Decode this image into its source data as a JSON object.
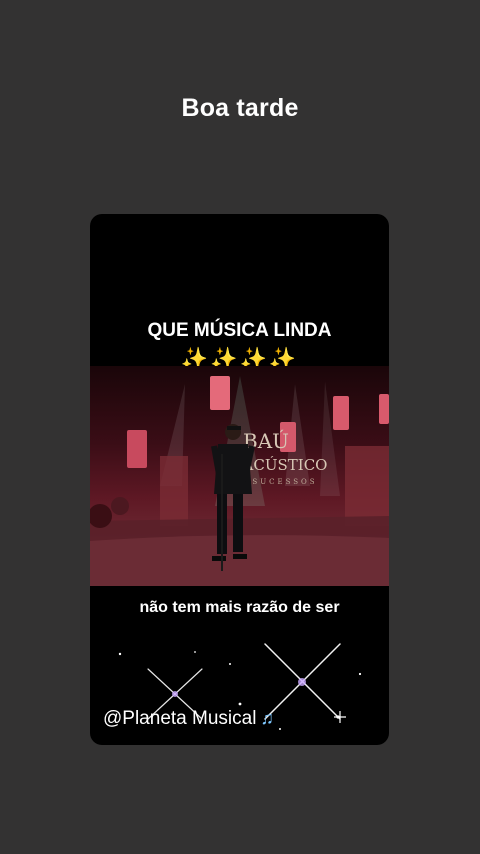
{
  "header": {
    "title": "Boa tarde"
  },
  "story": {
    "overlay_title": "QUE MÚSICA LINDA",
    "sparkles": "✨✨✨✨",
    "video": {
      "stage_sign_line1": "BAÚ",
      "stage_sign_line2": "ACÚSTICO",
      "stage_sign_line3": "SUCESSOS"
    },
    "caption": "não tem mais razão de ser",
    "handle": "@Planeta Musical",
    "handle_icon": "musical-notes-icon"
  },
  "colors": {
    "background": "#333232",
    "card": "#000000",
    "text": "#ffffff",
    "sparkle": "#ffd84a",
    "notes": "#7fc8ff"
  }
}
